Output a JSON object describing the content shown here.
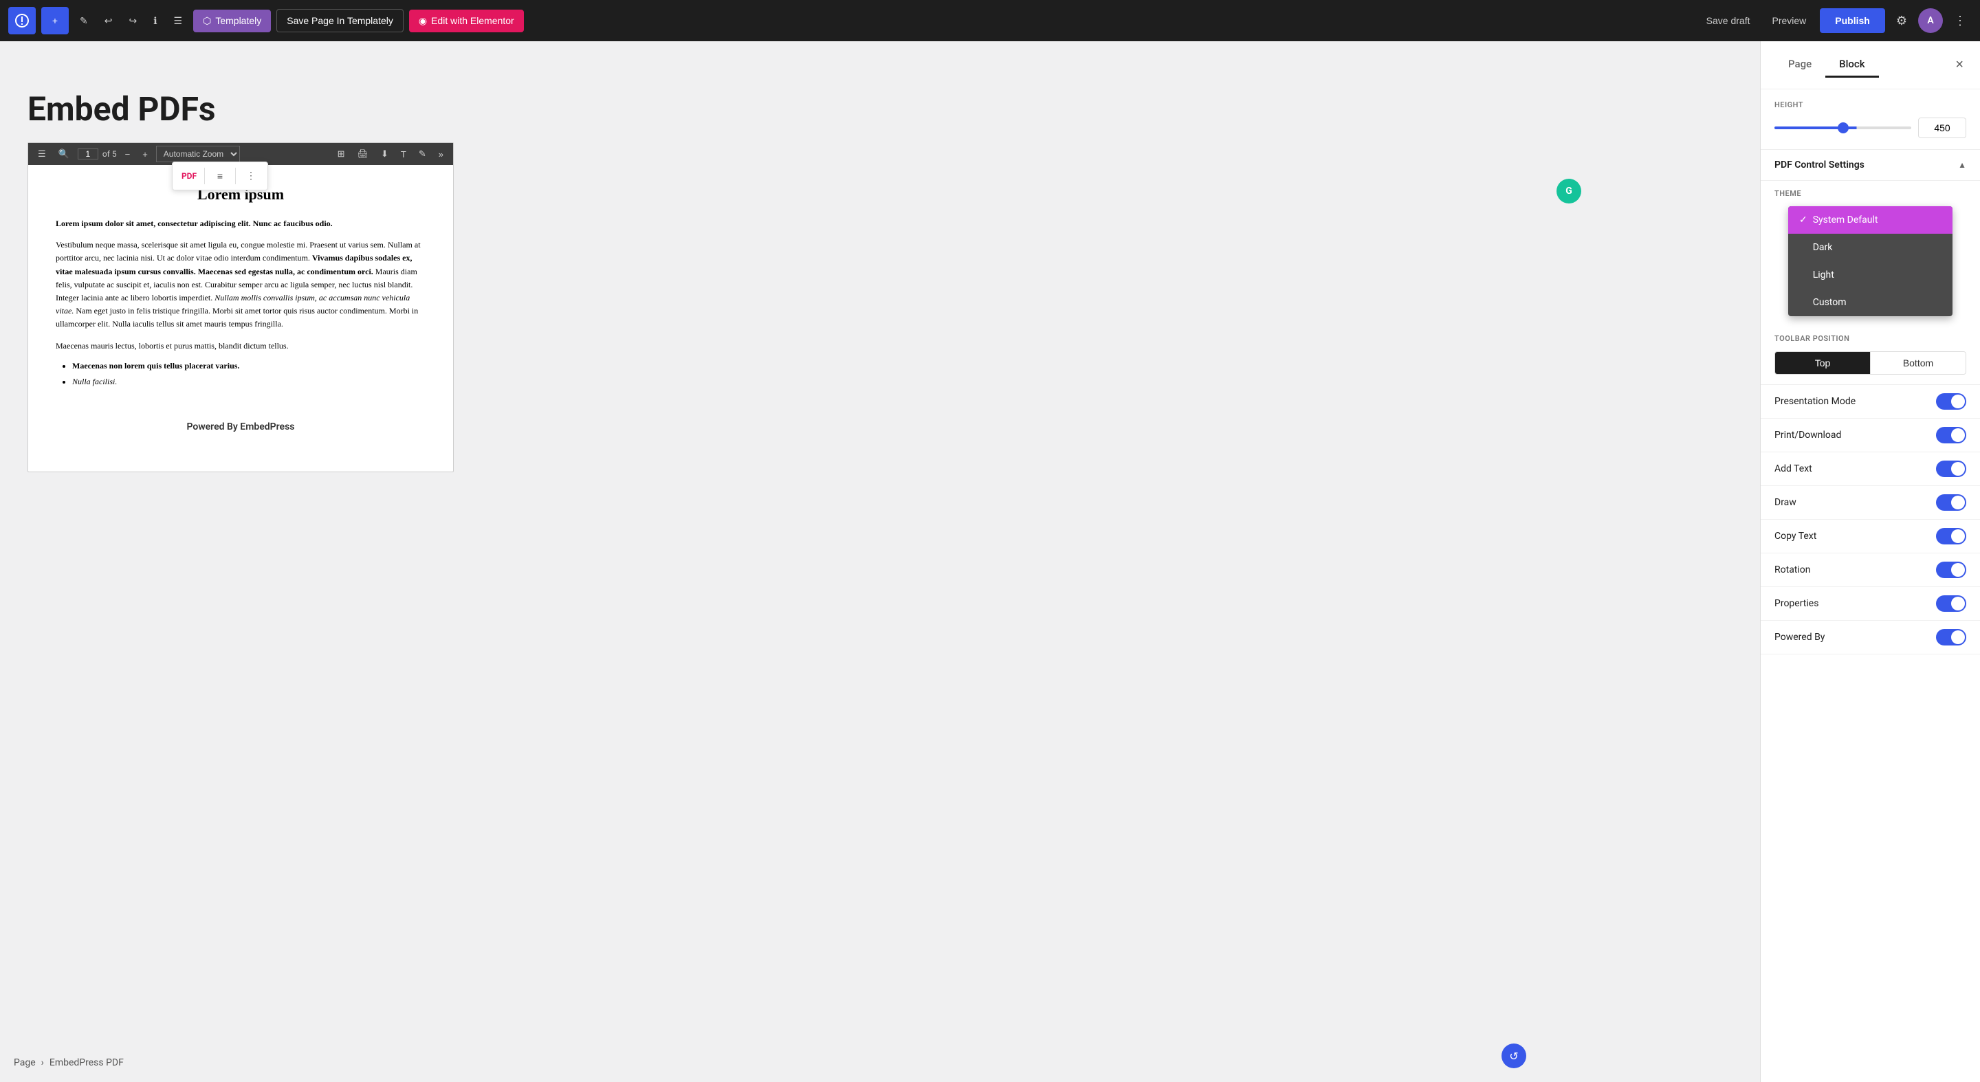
{
  "topbar": {
    "add_label": "+",
    "edit_label": "✎",
    "undo_label": "↩",
    "redo_label": "↪",
    "info_label": "ℹ",
    "list_label": "☰",
    "templately_label": "Templately",
    "save_templately_label": "Save Page In Templately",
    "elementor_label": "Edit with Elementor",
    "save_draft_label": "Save draft",
    "preview_label": "Preview",
    "publish_label": "Publish",
    "avatar_text": "A"
  },
  "editor": {
    "page_title": "Embed PDFs",
    "powered_by": "Powered By EmbedPress"
  },
  "pdf_toolbar": {
    "page_current": "1",
    "page_total": "of 5",
    "zoom_label": "Automatic Zoom"
  },
  "pdf_content": {
    "heading": "Lorem ipsum",
    "bold_para": "Lorem ipsum dolor sit amet, consectetur adipiscing elit. Nunc ac faucibus odio.",
    "para1": "Vestibulum neque massa, scelerisque sit amet ligula eu, congue molestie mi. Praesent ut varius sem. Nullam at porttitor arcu, nec lacinia nisi. Ut ac dolor vitae odio interdum condimentum.",
    "bold_mixed": "Vivamus dapibus sodales ex, vitae malesuada ipsum cursus convallis. Maecenas sed egestas nulla, ac condimentum orci.",
    "para2": "Mauris diam felis, vulputate ac suscipit et, iaculis non est. Curabitur semper arcu ac ligula semper, nec luctus nisl blandit. Integer lacinia ante ac libero lobortis imperdiet.",
    "italic_text": "Nullam mollis convallis ipsum, ac accumsan nunc vehicula vitae.",
    "para3": "Nam eget justo in felis tristique fringilla. Morbi sit amet tortor quis risus auctor condimentum. Morbi in ullamcorper elit. Nulla iaculis tellus sit amet mauris tempus fringilla.",
    "para4": "Maecenas mauris lectus, lobortis et purus mattis, blandit dictum tellus.",
    "list_item1": "Maecenas non lorem quis tellus placerat varius.",
    "list_item2": "Nulla facilisi."
  },
  "sidebar": {
    "page_tab": "Page",
    "block_tab": "Block",
    "close_label": "×",
    "height_label": "HEIGHT",
    "height_value": "450",
    "pdf_control_label": "PDF Control Settings",
    "theme_label": "THEME",
    "theme_options": [
      "System Default",
      "Dark",
      "Light",
      "Custom"
    ],
    "theme_selected": "System Default",
    "toolbar_pos_label": "TOOLBAR POSITION",
    "toolbar_pos_top": "Top",
    "toolbar_pos_bottom": "Bottom",
    "toggles": [
      {
        "label": "Presentation Mode",
        "state": "on"
      },
      {
        "label": "Print/Download",
        "state": "on"
      },
      {
        "label": "Add Text",
        "state": "on"
      },
      {
        "label": "Draw",
        "state": "on"
      },
      {
        "label": "Copy Text",
        "state": "on"
      },
      {
        "label": "Rotation",
        "state": "on"
      },
      {
        "label": "Properties",
        "state": "on"
      },
      {
        "label": "Powered By",
        "state": "on"
      }
    ]
  },
  "breadcrumb": {
    "page_label": "Page",
    "separator": "›",
    "current": "EmbedPress PDF"
  }
}
